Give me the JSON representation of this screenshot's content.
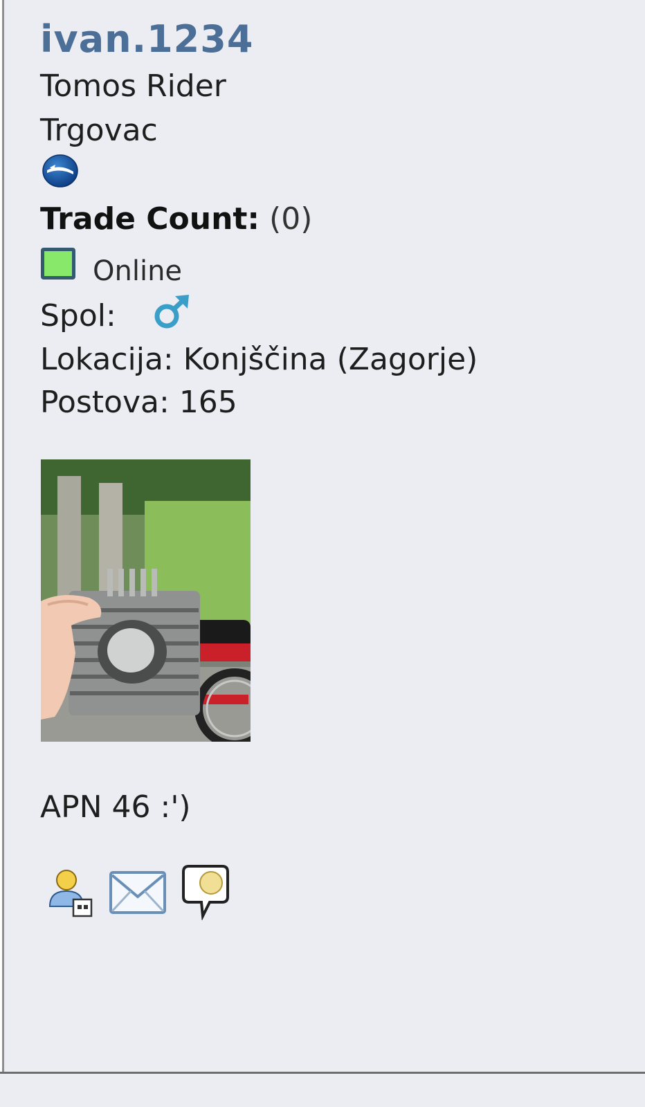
{
  "user": {
    "username": "ivan.1234",
    "title": "Tomos Rider",
    "rank": "Trgovac",
    "rank_icon": "blue-round-rank-icon"
  },
  "trade": {
    "label": "Trade Count:",
    "count": "(0)"
  },
  "status": {
    "text": "Online",
    "color": "#88e86a"
  },
  "gender": {
    "label": "Spol:",
    "icon": "male-symbol-icon",
    "color": "#3a9fc8"
  },
  "location": {
    "label": "Lokacija:",
    "value": "Konjščina (Zagorje)"
  },
  "posts": {
    "label": "Postova:",
    "value": "165"
  },
  "avatar": {
    "alt": "motorcycle cylinder photo"
  },
  "signature": "APN 46 :')",
  "actions": {
    "profile_icon": "user-profile-icon",
    "mail_icon": "envelope-icon",
    "chat_icon": "speech-bubble-icon"
  },
  "colors": {
    "panel_bg": "#ecedf3",
    "username": "#4b6f97",
    "online_border": "#335a71"
  }
}
